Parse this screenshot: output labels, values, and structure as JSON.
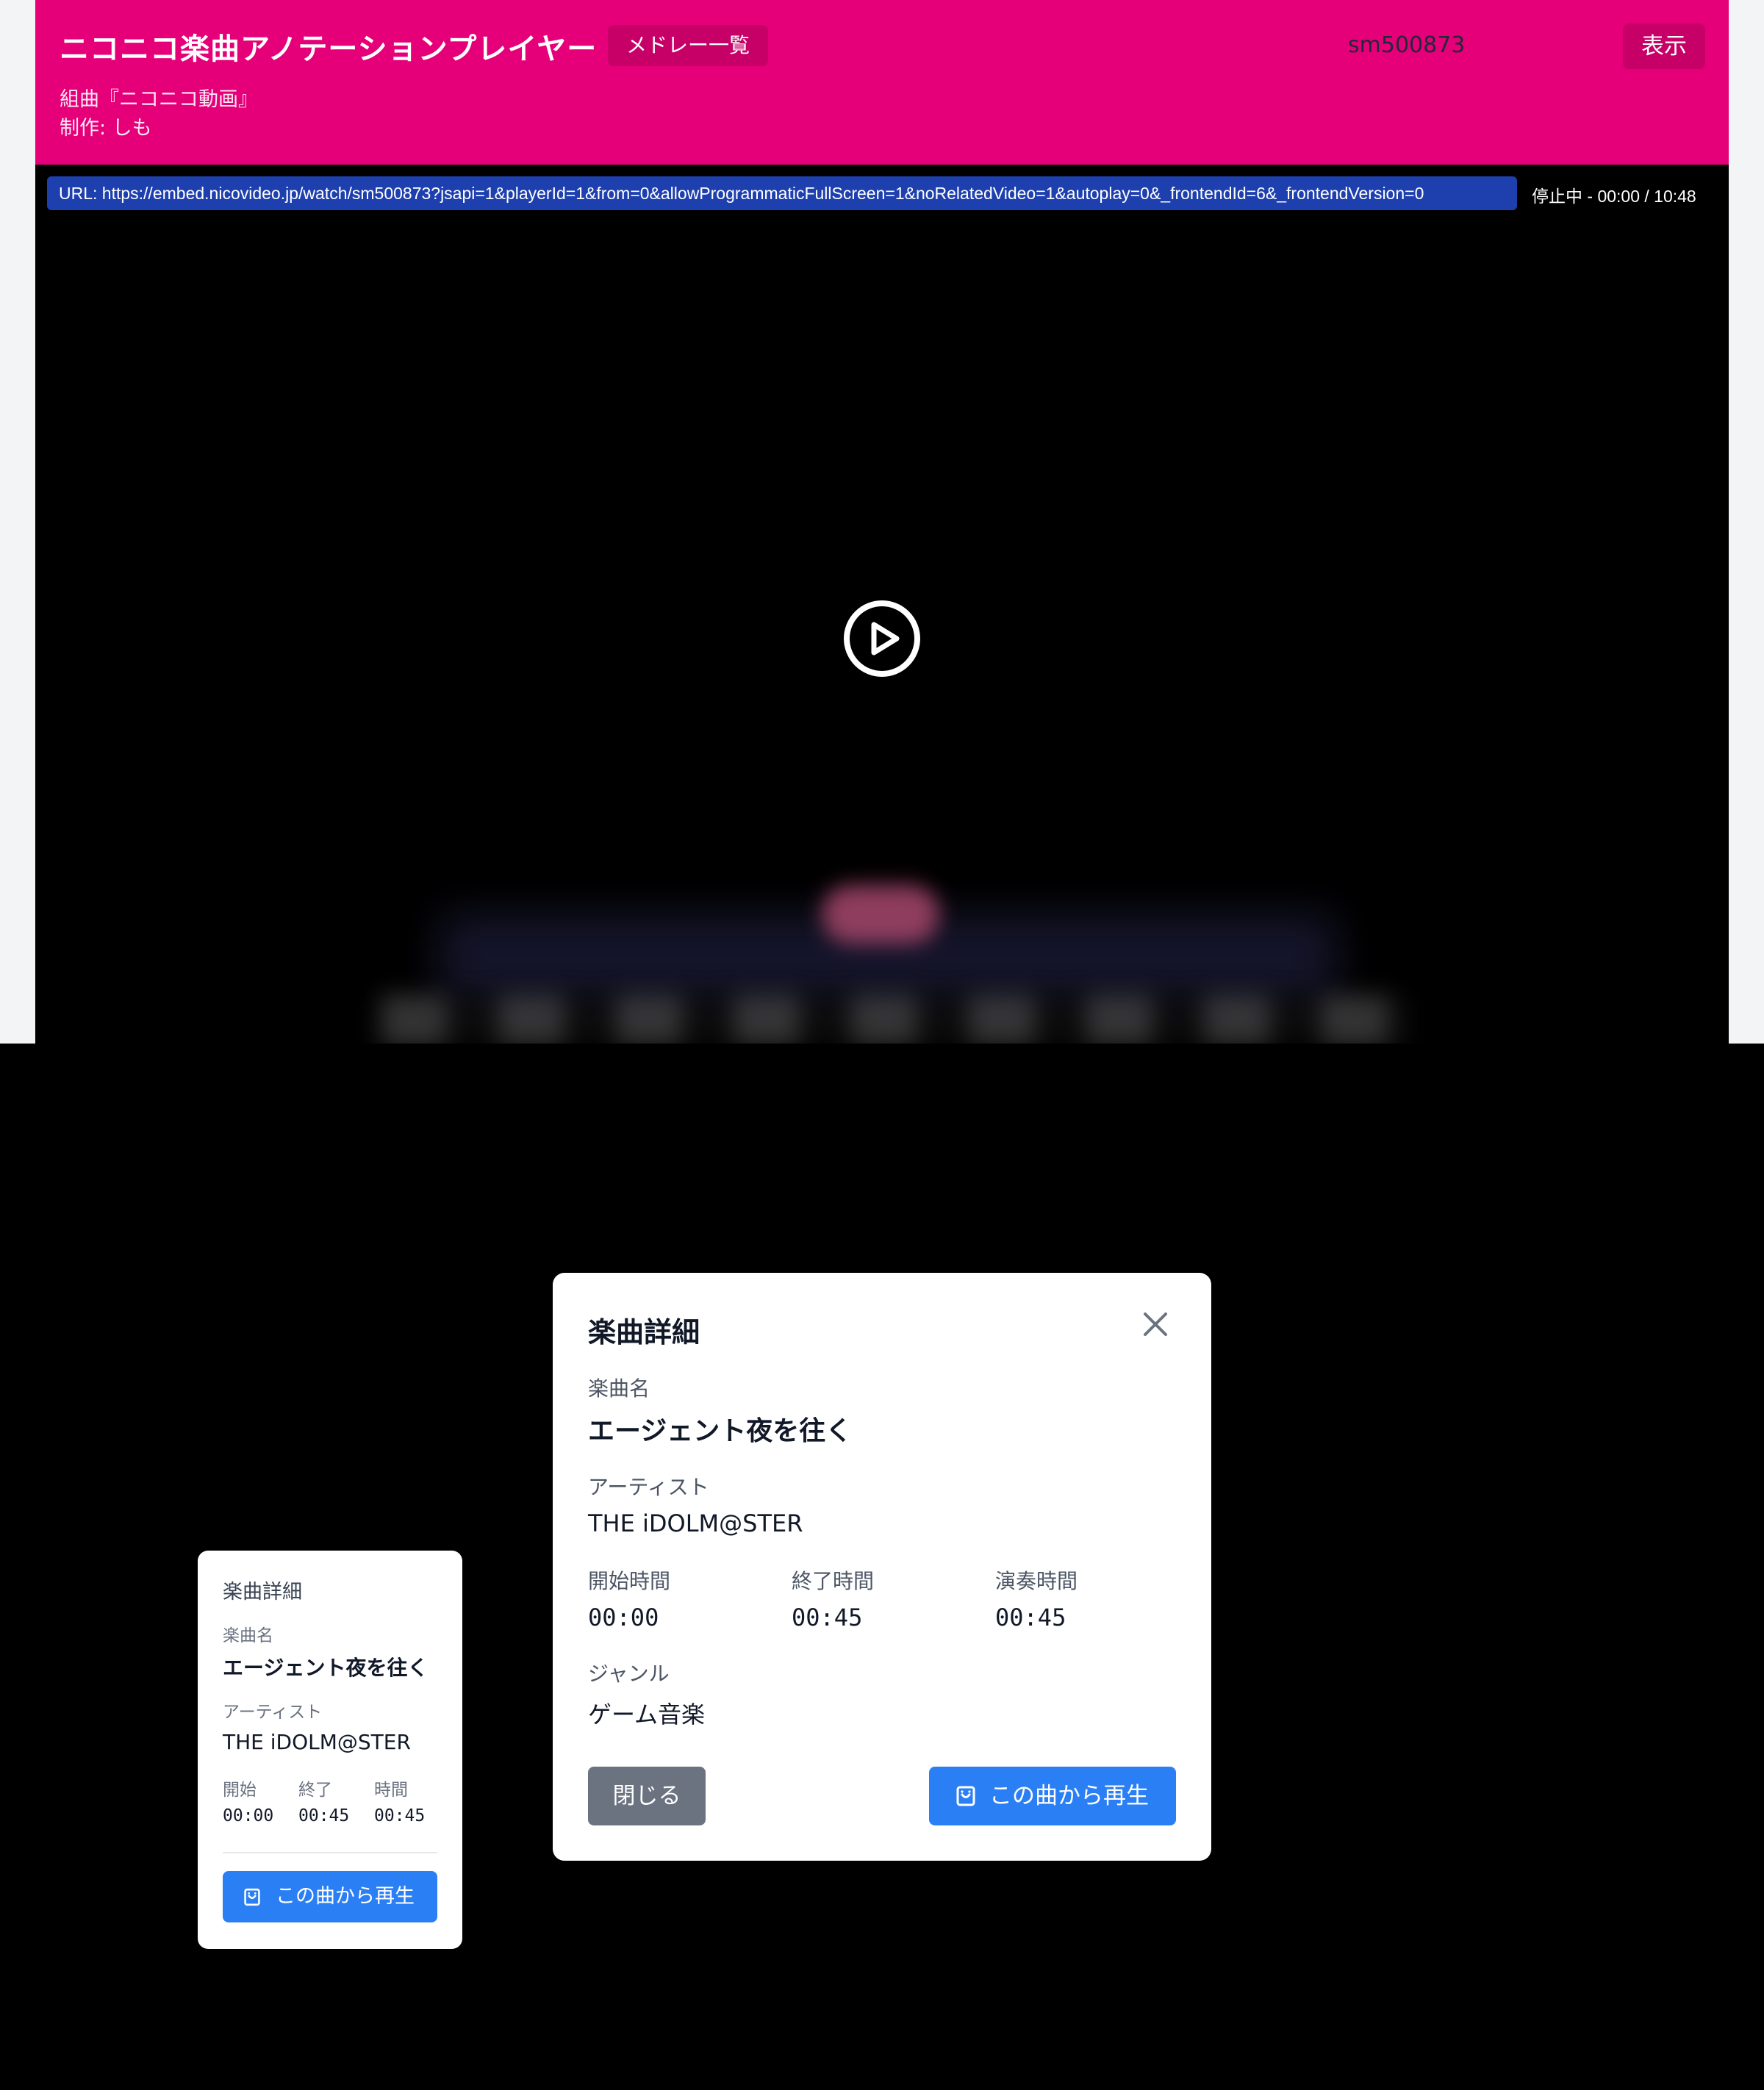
{
  "header": {
    "app_title": "ニコニコ楽曲アノテーションプレイヤー",
    "medley_list_label": "メドレー一覧",
    "video_id": "sm500873",
    "show_label": "表示",
    "medley_title": "組曲『ニコニコ動画』",
    "medley_author": "制作: しも"
  },
  "player": {
    "url": "URL: https://embed.nicovideo.jp/watch/sm500873?jsapi=1&playerId=1&from=0&allowProgrammaticFullScreen=1&noRelatedVideo=1&autoplay=0&_frontendId=6&_frontendVersion=0",
    "status": "停止中 - 00:00 / 10:48",
    "play_icon": "play-circle-icon"
  },
  "modal": {
    "title": "楽曲詳細",
    "close_icon": "close-icon",
    "song_label": "楽曲名",
    "song_name": "エージェント夜を往く",
    "artist_label": "アーティスト",
    "artist": "THE iDOLM@STER",
    "start_label": "開始時間",
    "start": "00:00",
    "end_label": "終了時間",
    "end": "00:45",
    "duration_label": "演奏時間",
    "duration": "00:45",
    "genre_label": "ジャンル",
    "genre": "ゲーム音楽",
    "close_button": "閉じる",
    "play_button": "この曲から再生",
    "play_icon": "play-from-song-icon"
  },
  "card": {
    "title": "楽曲詳細",
    "song_label": "楽曲名",
    "song_name": "エージェント夜を往く",
    "artist_label": "アーティスト",
    "artist": "THE iDOLM@STER",
    "start_label": "開始",
    "start": "00:00",
    "end_label": "終了",
    "end": "00:45",
    "duration_label": "時間",
    "duration": "00:45",
    "play_button": "この曲から再生",
    "play_icon": "play-from-song-icon"
  },
  "colors": {
    "header_bg": "#e5007a",
    "header_button_bg": "#c70068",
    "url_bar_bg": "#1e40af",
    "primary_button": "#2b7ff5",
    "secondary_button": "#6b7280"
  }
}
